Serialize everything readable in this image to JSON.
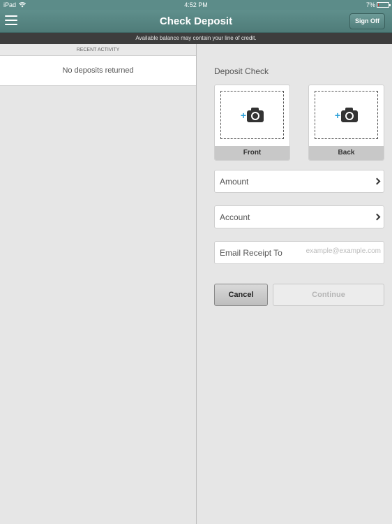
{
  "status_bar": {
    "device": "iPad",
    "time": "4:52 PM",
    "battery_percent": "7%",
    "battery_level": 0.07
  },
  "nav": {
    "title": "Check Deposit",
    "sign_off": "Sign Off"
  },
  "notice": "Available balance may contain your line of credit.",
  "recent_activity": {
    "header": "RECENT ACTIVITY",
    "empty_message": "No deposits returned"
  },
  "deposit": {
    "title": "Deposit Check",
    "front_label": "Front",
    "back_label": "Back",
    "amount_label": "Amount",
    "account_label": "Account",
    "email_label": "Email Receipt To",
    "email_placeholder": "example@example.com",
    "email_value": "",
    "cancel_label": "Cancel",
    "continue_label": "Continue"
  },
  "colors": {
    "header_teal": "#5f8f8c",
    "notice_bar": "#3d3d3d",
    "camera_plus": "#2a9fd8",
    "battery_low": "#d9302c"
  }
}
